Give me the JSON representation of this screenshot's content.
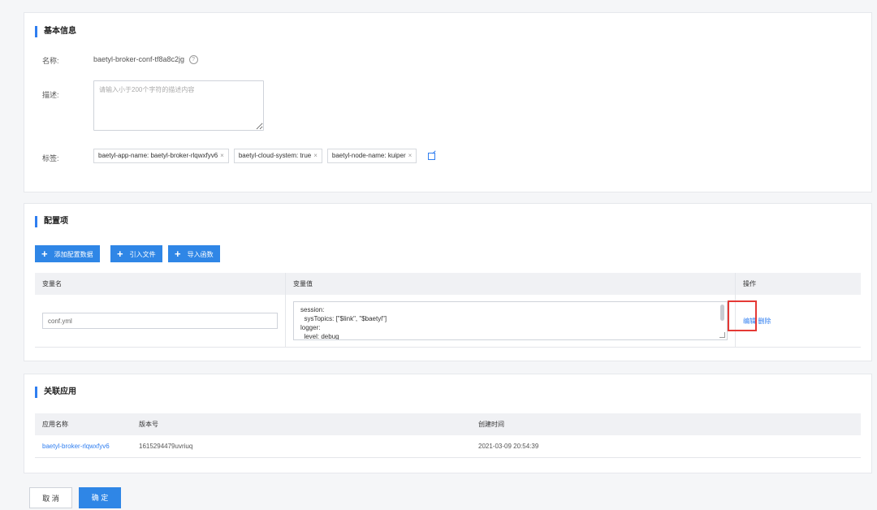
{
  "basic_info": {
    "title": "基本信息",
    "name_label": "名称:",
    "name_value": "baetyl-broker-conf-tf8a8c2jg",
    "desc_label": "描述:",
    "desc_placeholder": "请输入小于200个字符的描述内容",
    "tags_label": "标签:",
    "tags": [
      "baetyl-app-name: baetyl-broker-rlqwxfyv6",
      "baetyl-cloud-system: true",
      "baetyl-node-name: kuiper"
    ]
  },
  "config": {
    "title": "配置项",
    "buttons": [
      "添加配置数据",
      "引入文件",
      "导入函数"
    ],
    "columns": [
      "变量名",
      "变量值",
      "操作"
    ],
    "row": {
      "name": "conf.yml",
      "value": "session:\n  sysTopics: [\"$link\", \"$baetyl\"]\nlogger:\n  level: debug",
      "edit": "编辑",
      "delete": "删除"
    }
  },
  "apps": {
    "title": "关联应用",
    "columns": [
      "应用名称",
      "版本号",
      "创建时间"
    ],
    "rows": [
      [
        "baetyl-broker-rlqwxfyv6",
        "1615294479uvriuq",
        "2021-03-09 20:54:39"
      ]
    ]
  },
  "footer": {
    "cancel": "取 消",
    "confirm": "确 定"
  },
  "colors": {
    "accent": "#2f86e6",
    "highlight": "#e53935"
  }
}
